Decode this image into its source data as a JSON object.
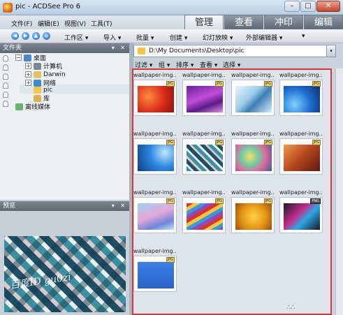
{
  "window": {
    "title": "pic - ACDSee Pro 6",
    "min": "–",
    "max": "□",
    "close": "✕"
  },
  "menu": [
    "文件(F)",
    "编辑(E)",
    "视图(V)",
    "工具(T)"
  ],
  "mode_tabs": [
    {
      "label": "管理",
      "active": true
    },
    {
      "label": "查看",
      "active": false
    },
    {
      "label": "冲印",
      "active": false
    },
    {
      "label": "编辑",
      "active": false
    }
  ],
  "toolbar": {
    "items": [
      "工作区 ▾",
      "导入 ▾",
      "批量 ▾",
      "创建 ▾",
      "幻灯放映 ▾",
      "外部编辑器 ▾",
      "▾"
    ]
  },
  "folders_panel": {
    "title": "文件夹",
    "controls": "▾ ✕",
    "tree": [
      {
        "label": "桌面",
        "icon": "desktop-icon",
        "expander": "−",
        "indent": 0
      },
      {
        "label": "计算机",
        "icon": "computer-icon",
        "expander": "+",
        "indent": 1
      },
      {
        "label": "Darwin",
        "icon": "user-folder-icon",
        "expander": "+",
        "indent": 1
      },
      {
        "label": "网络",
        "icon": "network-icon",
        "expander": "+",
        "indent": 1
      },
      {
        "label": "pic",
        "icon": "folder-icon",
        "expander": "",
        "indent": 1,
        "selected": true
      },
      {
        "label": "库",
        "icon": "library-icon",
        "expander": "",
        "indent": 1
      },
      {
        "label": "离线媒体",
        "icon": "offline-media-icon",
        "expander": "",
        "indent": 0
      }
    ]
  },
  "preview_panel": {
    "title": "预览",
    "controls": "▾ ✕",
    "watermark": "百度ID gu0zi"
  },
  "path": {
    "value": "D:\\My Documents\\Desktop\\pic",
    "dropdown": "▾"
  },
  "filter_bar": [
    "过滤 ▾",
    "组 ▾",
    "排序 ▾",
    "查看 ▾",
    "选择 ▾"
  ],
  "thumbnails": [
    {
      "label": "wallpaper-img...",
      "badge": "JPG",
      "palette": "red-swirl"
    },
    {
      "label": "wallpaper-img...",
      "badge": "JPG",
      "palette": "purple-waves"
    },
    {
      "label": "wallpaper-img...",
      "badge": "JPG",
      "palette": "light-blue-glass"
    },
    {
      "label": "wallpaper-img...",
      "badge": "JPG",
      "palette": "blue-gradient"
    },
    {
      "label": "wallpaper-img...",
      "badge": "JPG",
      "palette": "blue-light"
    },
    {
      "label": "wallpaper-img...",
      "badge": "JPG",
      "palette": "plaid"
    },
    {
      "label": "wallpaper-img...",
      "badge": "JPG",
      "palette": "colorful-blur"
    },
    {
      "label": "wallpaper-img...",
      "badge": "JPG",
      "palette": "copper"
    },
    {
      "label": "wallpaper-img...",
      "badge": "JPG",
      "palette": "pastel-pink-blue"
    },
    {
      "label": "wallpaper-img...",
      "badge": "JPG",
      "palette": "rainbow-stripes"
    },
    {
      "label": "wallpaper-img...",
      "badge": "JPG",
      "palette": "honeycomb"
    },
    {
      "label": "wallpaper-img...",
      "badge": "PNG",
      "palette": "dark-colorful"
    },
    {
      "label": "wallpaper-img...",
      "badge": "JPG",
      "palette": "solid-blue"
    }
  ],
  "colors": {
    "selection_outline": "#d63838",
    "accent": "#1e62b3"
  }
}
